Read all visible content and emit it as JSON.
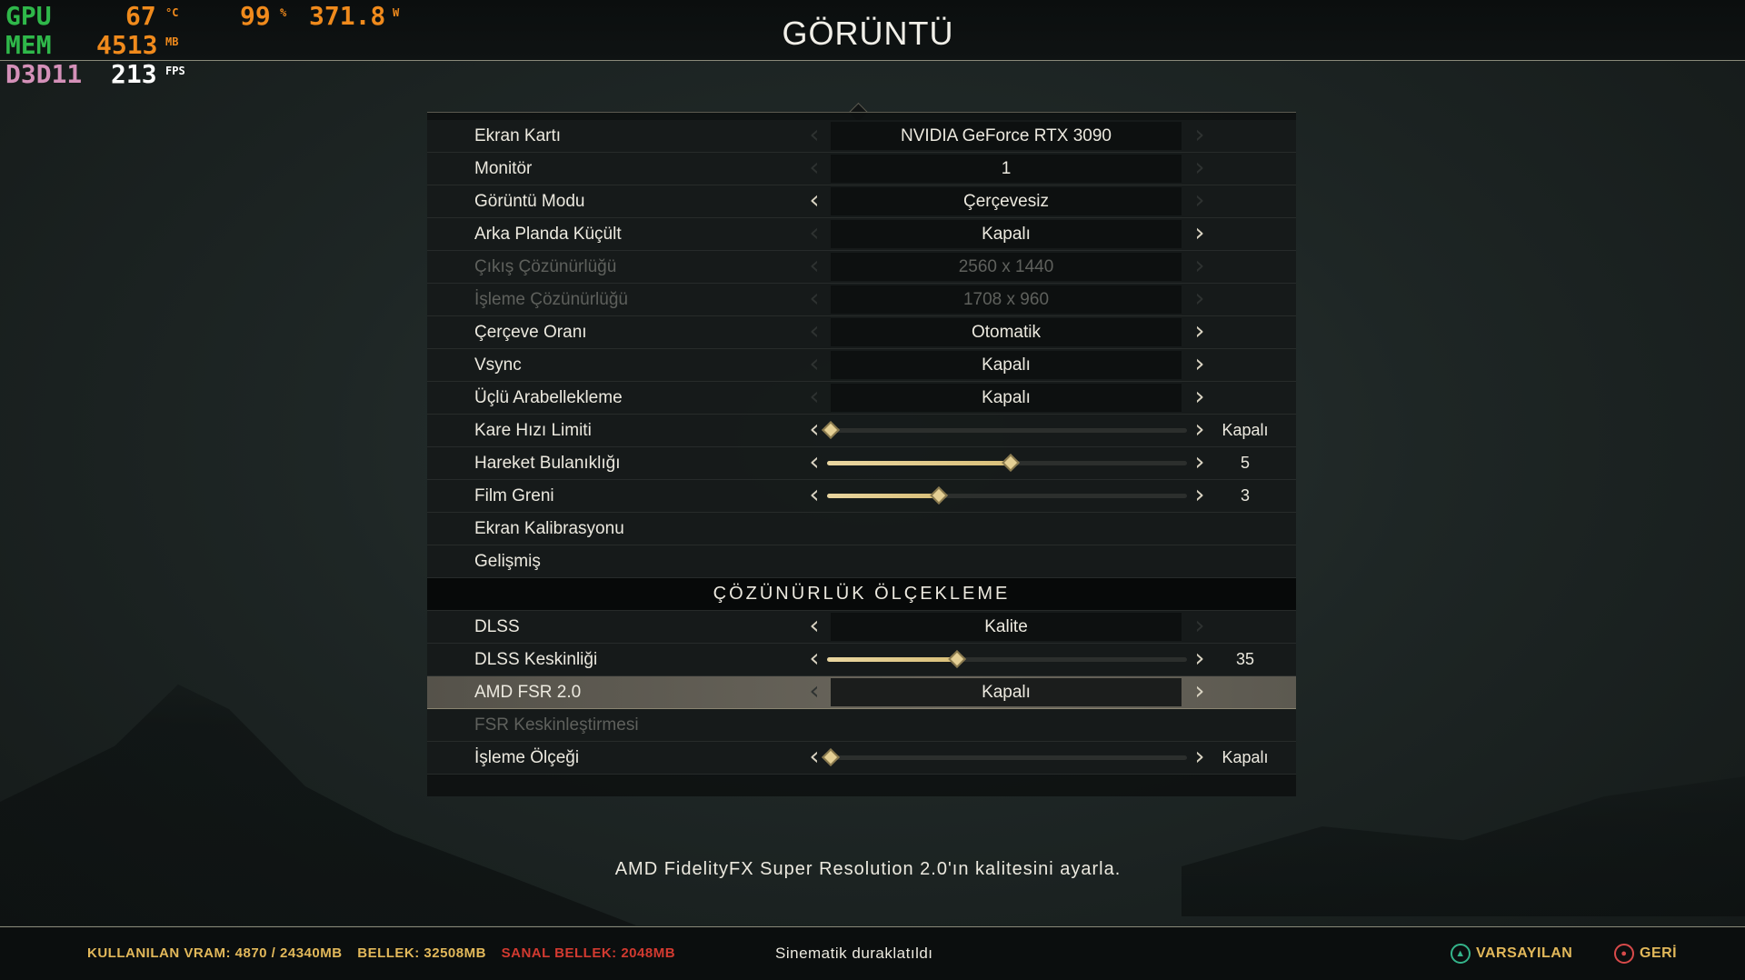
{
  "header": {
    "title": "GÖRÜNTÜ"
  },
  "osd": {
    "gpu_label": "GPU",
    "gpu_temp": "67",
    "gpu_temp_unit": "°C",
    "gpu_load": "99",
    "gpu_load_unit": "%",
    "gpu_power": "371.8",
    "gpu_power_unit": "W",
    "mem_label": "MEM",
    "mem_value": "4513",
    "mem_unit": "MB",
    "api_label": "D3D11",
    "fps_value": "213",
    "fps_unit": "FPS"
  },
  "settings": {
    "rows": [
      {
        "label": "Ekran Kartı",
        "value": "NVIDIA GeForce RTX 3090"
      },
      {
        "label": "Monitör",
        "value": "1"
      },
      {
        "label": "Görüntü Modu",
        "value": "Çerçevesiz"
      },
      {
        "label": "Arka Planda Küçült",
        "value": "Kapalı"
      },
      {
        "label": "Çıkış Çözünürlüğü",
        "value": "2560 x 1440"
      },
      {
        "label": "İşleme Çözünürlüğü",
        "value": "1708 x 960"
      },
      {
        "label": "Çerçeve Oranı",
        "value": "Otomatik"
      },
      {
        "label": "Vsync",
        "value": "Kapalı"
      },
      {
        "label": "Üçlü Arabellekleme",
        "value": "Kapalı"
      },
      {
        "label": "Kare Hızı Limiti",
        "value": "Kapalı",
        "slider_fraction": 0.0
      },
      {
        "label": "Hareket Bulanıklığı",
        "value": "5",
        "slider_fraction": 0.5
      },
      {
        "label": "Film Greni",
        "value": "3",
        "slider_fraction": 0.3
      },
      {
        "label": "Ekran Kalibrasyonu"
      },
      {
        "label": "Gelişmiş"
      }
    ],
    "section_title": "ÇÖZÜNÜRLÜK ÖLÇEKLEME",
    "scaling_rows": [
      {
        "label": "DLSS",
        "value": "Kalite"
      },
      {
        "label": "DLSS Keskinliği",
        "value": "35",
        "slider_fraction": 0.35
      },
      {
        "label": "AMD FSR 2.0",
        "value": "Kapalı"
      },
      {
        "label": "FSR Keskinleştirmesi"
      },
      {
        "label": "İşleme Ölçeği",
        "value": "Kapalı",
        "slider_fraction": 0.0
      }
    ]
  },
  "description": "AMD FidelityFX Super Resolution 2.0'ın kalitesini ayarla.",
  "footer": {
    "vram": "KULLANILAN VRAM: 4870 / 24340MB",
    "memory": "BELLEK: 32508MB",
    "virtual_memory": "SANAL BELLEK: 2048MB",
    "status": "Sinematik duraklatıldı",
    "default_label": "VARSAYILAN",
    "back_label": "GERİ"
  }
}
